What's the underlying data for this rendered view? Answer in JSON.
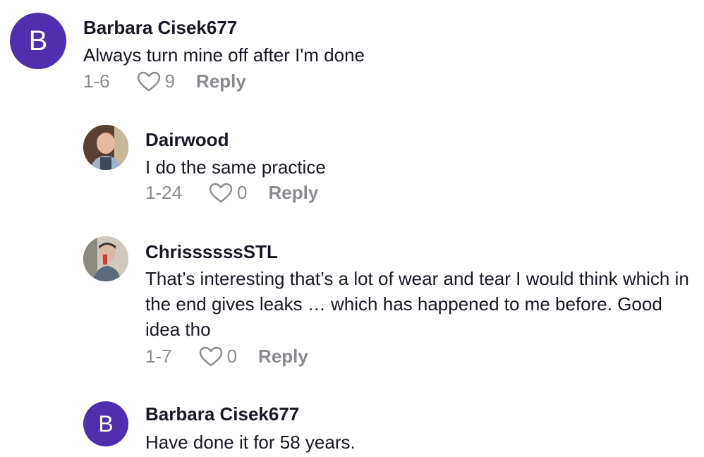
{
  "colors": {
    "avatar_letter_bg": "#4f2fae",
    "meta_gray": "#8a8b91",
    "text": "#161823"
  },
  "comments": [
    {
      "username": "Barbara Cisek677",
      "avatar_letter": "B",
      "text": "Always turn mine off after I'm done",
      "date": "1-6",
      "likes": "9",
      "reply_label": "Reply"
    },
    {
      "username": "Dairwood",
      "avatar_icon": "profile-photo",
      "text": "I do the same practice",
      "date": "1-24",
      "likes": "0",
      "reply_label": "Reply"
    },
    {
      "username": "ChrissssssSTL",
      "avatar_icon": "profile-photo",
      "text": "That’s interesting that’s a lot of wear and tear I would think which in the end gives leaks … which has happened to me before. Good idea tho",
      "date": "1-7",
      "likes": "0",
      "reply_label": "Reply"
    },
    {
      "username": "Barbara Cisek677",
      "avatar_letter": "B",
      "text": "Have done it for 58 years."
    }
  ]
}
